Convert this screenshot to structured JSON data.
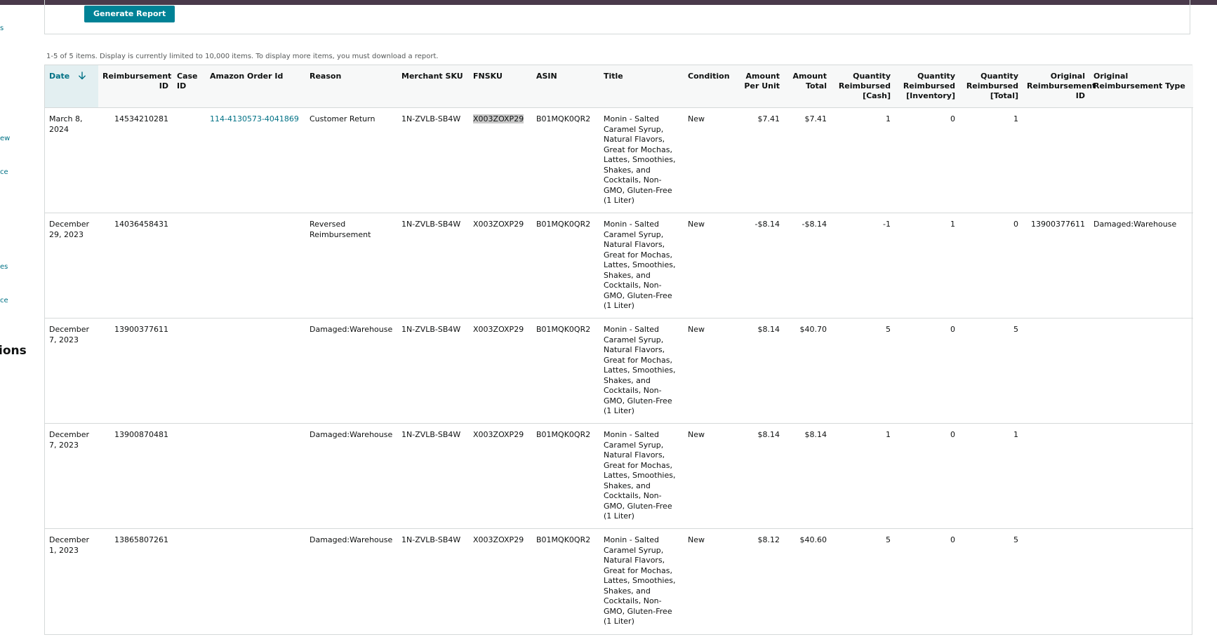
{
  "actions": {
    "generate_report_label": "Generate Report"
  },
  "sidebar_fragments": [
    "s",
    "ew",
    "ce",
    "es",
    "ce"
  ],
  "sidebar_heading_fragment": "ions",
  "items_info": "1-5 of 5 items. Display is currently limited to 10,000 items. To display more items, you must download a report.",
  "table": {
    "columns": [
      "Date",
      "Reimbursement ID",
      "Case ID",
      "Amazon Order Id",
      "Reason",
      "Merchant SKU",
      "FNSKU",
      "ASIN",
      "Title",
      "Condition",
      "Amount Per Unit",
      "Amount Total",
      "Quantity Reimbursed [Cash]",
      "Quantity Reimbursed [Inventory]",
      "Quantity Reimbursed [Total]",
      "Original Reimbursement ID",
      "Original Reimbursement Type"
    ],
    "rows": [
      [
        "March 8, 2024",
        "14534210281",
        "",
        "114-4130573-4041869",
        "Customer Return",
        "1N-ZVLB-SB4W",
        "X003ZOXP29",
        "B01MQK0QR2",
        "Monin - Salted Caramel Syrup, Natural Flavors, Great for Mochas, Lattes, Smoothies, Shakes, and Cocktails, Non-GMO, Gluten-Free (1 Liter)",
        "New",
        "$7.41",
        "$7.41",
        "1",
        "0",
        "1",
        "",
        ""
      ],
      [
        "December 29, 2023",
        "14036458431",
        "",
        "",
        "Reversed Reimbursement",
        "1N-ZVLB-SB4W",
        "X003ZOXP29",
        "B01MQK0QR2",
        "Monin - Salted Caramel Syrup, Natural Flavors, Great for Mochas, Lattes, Smoothies, Shakes, and Cocktails, Non-GMO, Gluten-Free (1 Liter)",
        "New",
        "-$8.14",
        "-$8.14",
        "-1",
        "1",
        "0",
        "13900377611",
        "Damaged:Warehouse"
      ],
      [
        "December 7, 2023",
        "13900377611",
        "",
        "",
        "Damaged:Warehouse",
        "1N-ZVLB-SB4W",
        "X003ZOXP29",
        "B01MQK0QR2",
        "Monin - Salted Caramel Syrup, Natural Flavors, Great for Mochas, Lattes, Smoothies, Shakes, and Cocktails, Non-GMO, Gluten-Free (1 Liter)",
        "New",
        "$8.14",
        "$40.70",
        "5",
        "0",
        "5",
        "",
        ""
      ],
      [
        "December 7, 2023",
        "13900870481",
        "",
        "",
        "Damaged:Warehouse",
        "1N-ZVLB-SB4W",
        "X003ZOXP29",
        "B01MQK0QR2",
        "Monin - Salted Caramel Syrup, Natural Flavors, Great for Mochas, Lattes, Smoothies, Shakes, and Cocktails, Non-GMO, Gluten-Free (1 Liter)",
        "New",
        "$8.14",
        "$8.14",
        "1",
        "0",
        "1",
        "",
        ""
      ],
      [
        "December 1, 2023",
        "13865807261",
        "",
        "",
        "Damaged:Warehouse",
        "1N-ZVLB-SB4W",
        "X003ZOXP29",
        "B01MQK0QR2",
        "Monin - Salted Caramel Syrup, Natural Flavors, Great for Mochas, Lattes, Smoothies, Shakes, and Cocktails, Non-GMO, Gluten-Free (1 Liter)",
        "New",
        "$8.12",
        "$40.60",
        "5",
        "0",
        "5",
        "",
        ""
      ]
    ]
  },
  "colors": {
    "accent": "#008296",
    "link": "#007185",
    "topbar": "#4a3a4b",
    "border": "#d5d9d9"
  },
  "icons": {
    "sort": "arrow-down-icon"
  }
}
